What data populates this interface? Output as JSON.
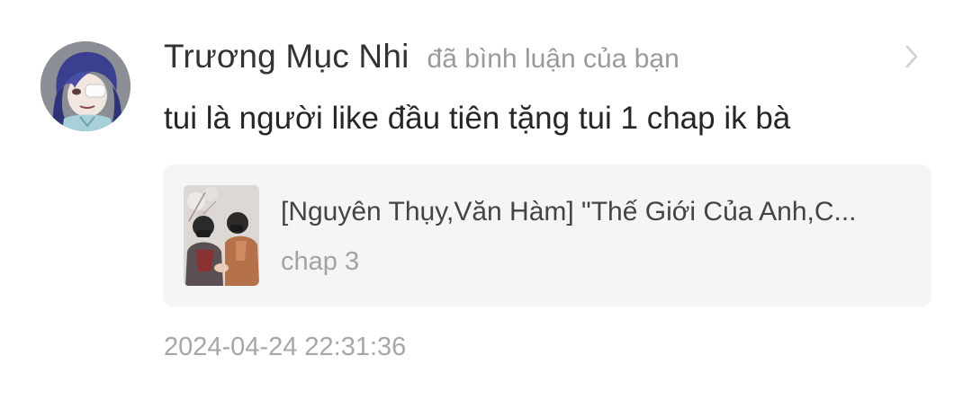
{
  "notification": {
    "user_name": "Trương Mục Nhi",
    "action_text": "đã bình luận của bạn",
    "comment_text": "tui là người like đầu tiên tặng tui 1 chap ik bà",
    "story": {
      "title": "[Nguyên Thụy,Văn Hàm] \"Thế Giới Của Anh,C...",
      "chapter": "chap 3"
    },
    "timestamp": "2024-04-24 22:31:36"
  },
  "icons": {
    "chevron": "chevron-right-icon"
  },
  "colors": {
    "background": "#ffffff",
    "name_text": "#333333",
    "secondary_text": "#9a9a9a",
    "card_background": "#f5f5f5"
  }
}
